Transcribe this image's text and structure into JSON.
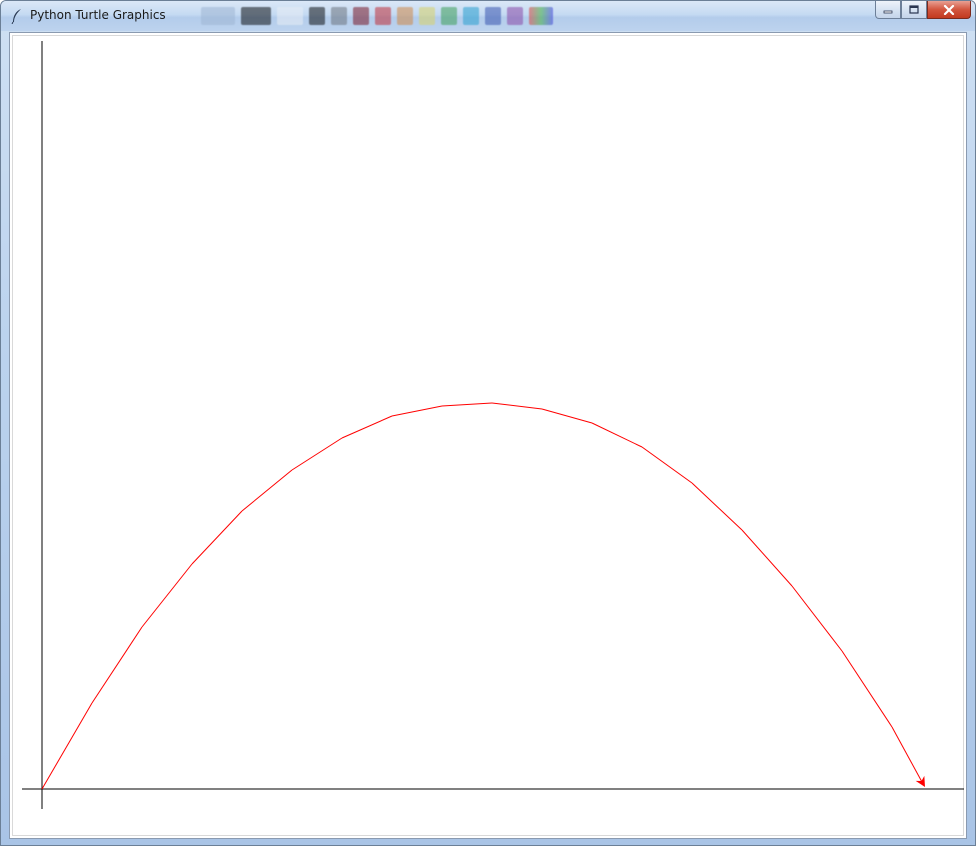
{
  "window": {
    "title": "Python Turtle Graphics",
    "app_icon": "feather-icon",
    "controls": [
      "minimize-icon",
      "maximize-icon",
      "close-icon"
    ]
  },
  "colors": {
    "axes": "#000000",
    "trajectory": "#ff0000",
    "turtle": "#ff0000"
  },
  "turtle": {
    "heading_deg": -60,
    "shape": "arrow",
    "icon": "turtle-arrow-icon"
  },
  "trajectory_points": [
    [
      0,
      0
    ],
    [
      50,
      86
    ],
    [
      100,
      162
    ],
    [
      150,
      225
    ],
    [
      200,
      278
    ],
    [
      250,
      319
    ],
    [
      300,
      351
    ],
    [
      350,
      373
    ],
    [
      400,
      383
    ],
    [
      450,
      386
    ],
    [
      500,
      380
    ],
    [
      550,
      366
    ],
    [
      600,
      342
    ],
    [
      650,
      306
    ],
    [
      700,
      259
    ],
    [
      750,
      203
    ],
    [
      800,
      138
    ],
    [
      850,
      62
    ],
    [
      880,
      7
    ]
  ]
}
